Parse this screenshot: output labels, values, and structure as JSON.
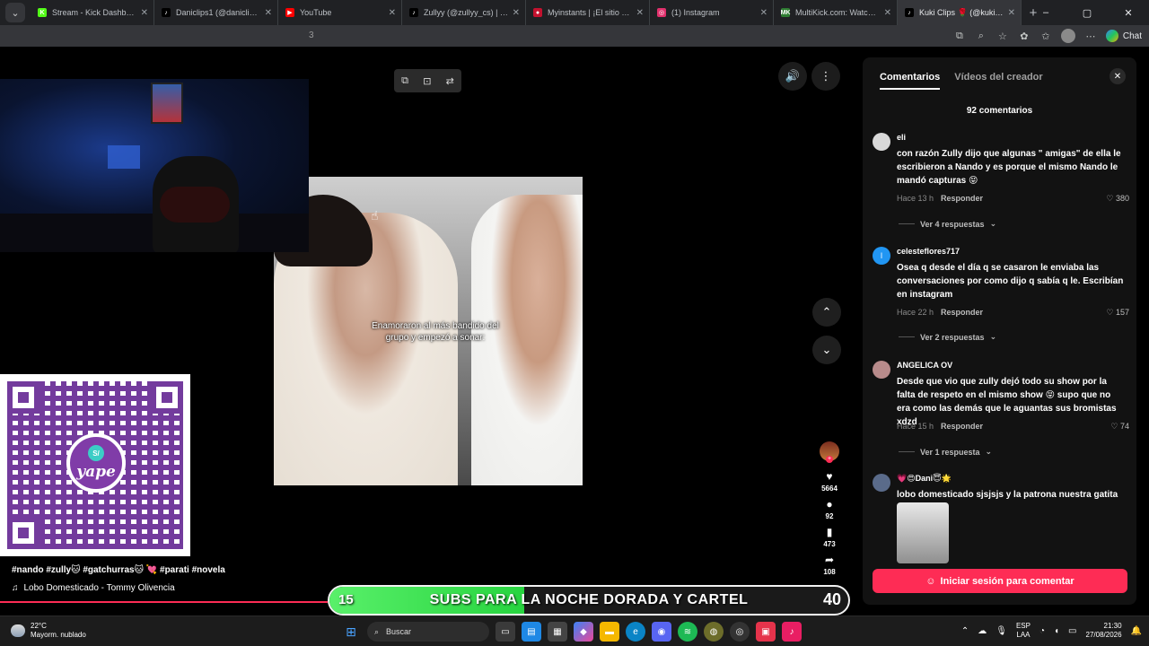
{
  "browser": {
    "tabs": [
      {
        "title": "Stream - Kick Dashboard",
        "favicon": "K",
        "color": "#53fc18",
        "active": false
      },
      {
        "title": "Daniclips1 (@daniclips_pe2)",
        "favicon": "♪",
        "color": "#000000",
        "active": false
      },
      {
        "title": "YouTube",
        "favicon": "▶",
        "color": "#ff0000",
        "active": false
      },
      {
        "title": "Zullyy (@zullyy_cs) | TikTok",
        "favicon": "♪",
        "color": "#000000",
        "active": false
      },
      {
        "title": "Myinstants | ¡El sitio web de",
        "favicon": "●",
        "color": "#c4122f",
        "active": false
      },
      {
        "title": "(1) Instagram",
        "favicon": "◎",
        "color": "#e1306c",
        "active": false
      },
      {
        "title": "MultiKick.com: Watch Multip",
        "favicon": "MK",
        "color": "#2e7d32",
        "active": false
      },
      {
        "title": "Kuki Clips 🌹 (@kuki_cl",
        "favicon": "♪",
        "color": "#000000",
        "active": true
      }
    ],
    "new_tab": "+",
    "window_controls": [
      "–",
      "▢",
      "✕"
    ],
    "toolbar_partial_text": "3",
    "chat_label": "Chat"
  },
  "video": {
    "caption": "Enamoraron al más bandido del grupo y empezó a sonar:",
    "controls": [
      "⧉",
      "⊡",
      "⇄"
    ],
    "volume_icon": "🔊",
    "more_icon": "⋮",
    "nav_up": "⌃",
    "nav_down": "⌄",
    "hashtags": "#nando #zully🐱 #gatchurras🐱 💘 #parati #novela",
    "music_note": "♫",
    "music": "Lobo Domesticado - Tommy Olivencia",
    "progress": 0.285
  },
  "actions": {
    "likes": "5664",
    "comments": "92",
    "saves": "473",
    "shares": "108"
  },
  "qr": {
    "badge": "S/",
    "brand": "yape"
  },
  "goal": {
    "current": "15",
    "text": "SUBS PARA LA NOCHE DORADA Y CARTEL",
    "target": "40",
    "progress": 0.375
  },
  "comments_panel": {
    "tabs": [
      "Comentarios",
      "Vídeos del creador"
    ],
    "close": "✕",
    "count": "92 comentarios",
    "comments": [
      {
        "user": "eli",
        "text": "con razón Zully dijo que algunas \" amigas\" de ella le escribieron a Nando y es porque el mismo Nando le mandó capturas 😝",
        "time": "Hace 13 h",
        "reply": "Responder",
        "likes": "380",
        "more": "Ver 4 respuestas",
        "avatar_color": "#d9d9d9",
        "avatar_letter": ""
      },
      {
        "user": "celesteflores717",
        "text": "Osea q desde el día q se casaron le enviaba las conversaciones por como dijo q sabía q le. Escribían en instagram",
        "time": "Hace 22 h",
        "reply": "Responder",
        "likes": "157",
        "more": "Ver 2 respuestas",
        "avatar_color": "#2196f3",
        "avatar_letter": "l"
      },
      {
        "user": "ANGELICA OV",
        "text": "Desde que vio que zully dejó todo su show por la falta de respeto en el mismo show 😝 supo que no era como las demás que le aguantas sus bromistas xdzd",
        "time": "Hace 15 h",
        "reply": "Responder",
        "likes": "74",
        "more": "Ver 1 respuesta",
        "avatar_color": "#b88b8b",
        "avatar_letter": ""
      },
      {
        "user": "💗😍Dani😇🌟",
        "text": "lobo domesticado sjsjsjs y la patrona nuestra gatita",
        "avatar_color": "#5a6b8a",
        "avatar_letter": ""
      }
    ],
    "login_label": "Iniciar sesión para comentar"
  },
  "taskbar": {
    "temp": "22°C",
    "weather": "Mayorm. nublado",
    "search": "Buscar",
    "lang": "ESP",
    "lang2": "LAA",
    "time": "21:30",
    "date": "27/08/2026"
  }
}
